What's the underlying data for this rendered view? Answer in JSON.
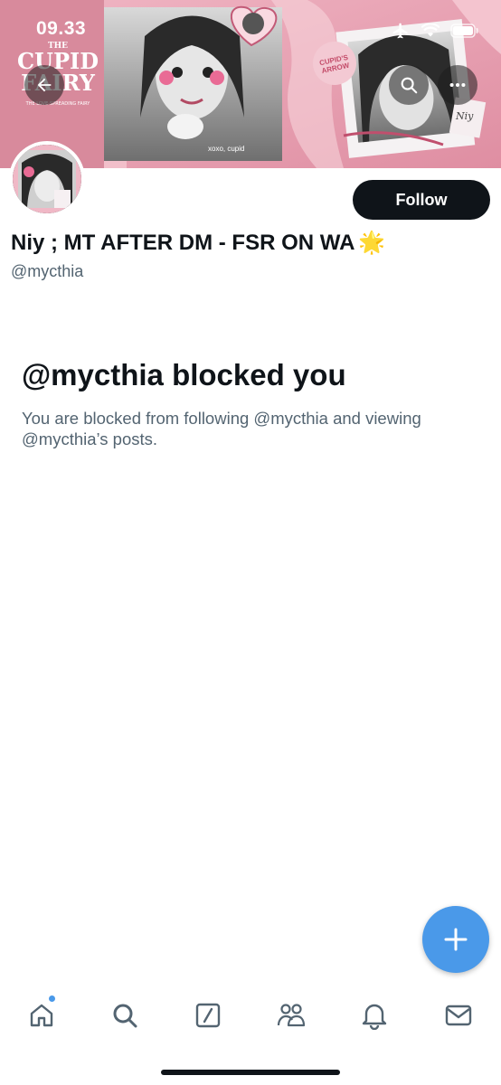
{
  "status_bar": {
    "time": "09.33"
  },
  "header": {
    "banner_text": {
      "the": "THE",
      "line1": "CUPID",
      "line2": "FAIRY",
      "tagline": "THE LOVE-SPREADING FAIRY",
      "stamp": "CUPID'S ARROW",
      "sticker": "Niy",
      "caption": "xoxo, cupid"
    }
  },
  "profile": {
    "display_name": "Niy ; MT AFTER DM - FSR ON WA",
    "name_emoji": "🌟",
    "handle": "@mycthia",
    "follow_label": "Follow"
  },
  "blocked": {
    "title": "@mycthia blocked you",
    "message": "You are blocked from following @mycthia and viewing @mycthia’s posts."
  },
  "tabs": [
    "home",
    "search",
    "grok",
    "communities",
    "notifications",
    "messages"
  ],
  "colors": {
    "accent": "#4a99e9",
    "text": "#0f1419",
    "secondary": "#536471",
    "banner_pink": "#e9a7b6"
  }
}
